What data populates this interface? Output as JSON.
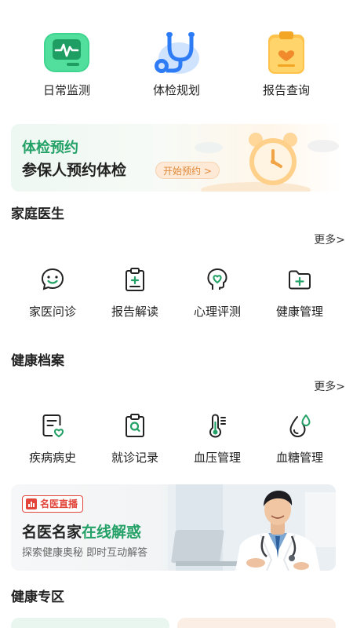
{
  "top_tiles": [
    {
      "label": "日常监测",
      "icon": "monitor-icon"
    },
    {
      "label": "体检规划",
      "icon": "stethoscope-icon"
    },
    {
      "label": "报告查询",
      "icon": "report-clipboard-icon"
    }
  ],
  "booking_banner": {
    "title": "体检预约",
    "subtitle": "参保人预约体检",
    "cta": "开始预约 >",
    "icon": "alarm-clock-icon"
  },
  "family_doctor": {
    "title": "家庭医生",
    "more": "更多>",
    "items": [
      {
        "label": "家医问诊",
        "icon": "smile-chat-icon"
      },
      {
        "label": "报告解读",
        "icon": "clipboard-plus-icon"
      },
      {
        "label": "心理评测",
        "icon": "head-heart-icon"
      },
      {
        "label": "健康管理",
        "icon": "folder-plus-icon"
      }
    ]
  },
  "health_records": {
    "title": "健康档案",
    "more": "更多>",
    "items": [
      {
        "label": "疾病病史",
        "icon": "document-heart-icon"
      },
      {
        "label": "就诊记录",
        "icon": "clipboard-search-icon"
      },
      {
        "label": "血压管理",
        "icon": "thermometer-icon"
      },
      {
        "label": "血糖管理",
        "icon": "blood-drop-icon"
      }
    ]
  },
  "live_banner": {
    "badge": "名医直播",
    "title_black": "名医名家",
    "title_green": "在线解惑",
    "subtitle": "探索健康奥秘 即时互动解答",
    "image": "doctor-photo"
  },
  "health_zone": {
    "title": "健康专区"
  },
  "colors": {
    "brand_green": "#23a166",
    "accent_orange": "#e08a3a",
    "live_red": "#e2463a"
  }
}
